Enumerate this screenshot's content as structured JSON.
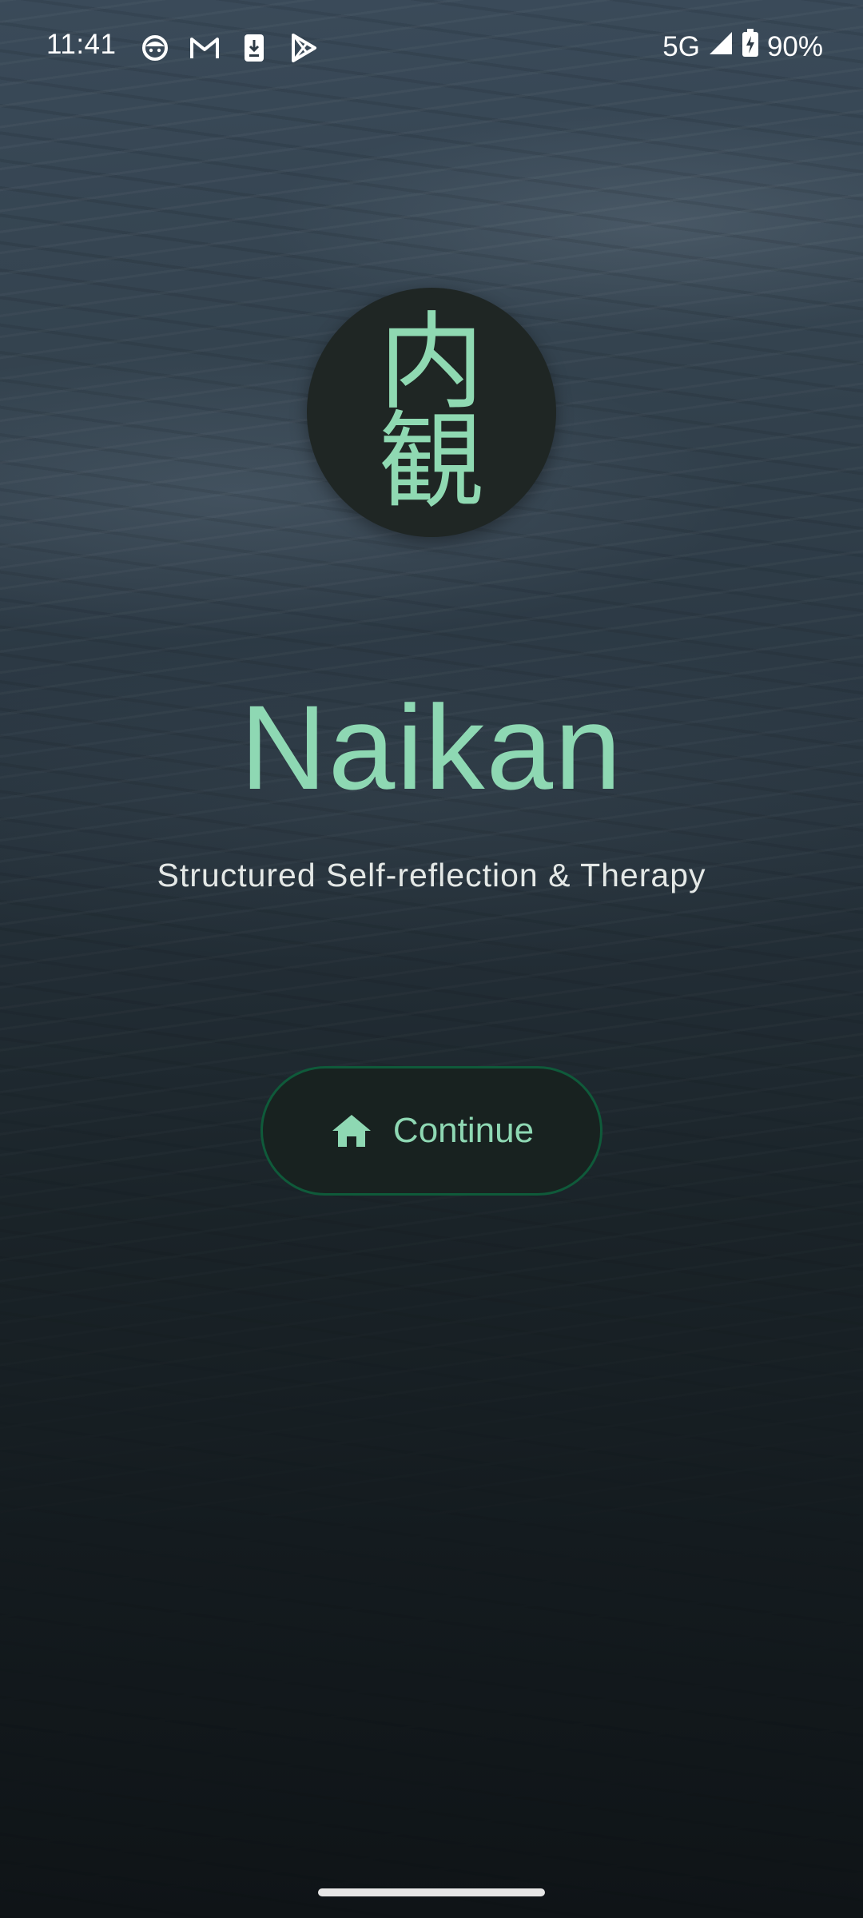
{
  "status_bar": {
    "time": "11:41",
    "network": "5G",
    "battery": "90%",
    "icons": [
      "notification-face-icon",
      "gmail-icon",
      "phone-download-icon",
      "play-store-icon",
      "signal-icon",
      "battery-charging-icon"
    ]
  },
  "logo": {
    "kanji_top": "内",
    "kanji_bottom": "観",
    "color": "#8fd9b2"
  },
  "app": {
    "title": "Naikan",
    "subtitle": "Structured Self-reflection & Therapy"
  },
  "actions": {
    "continue_label": "Continue",
    "continue_icon": "home-icon",
    "accent_color": "#8ed8b3"
  }
}
